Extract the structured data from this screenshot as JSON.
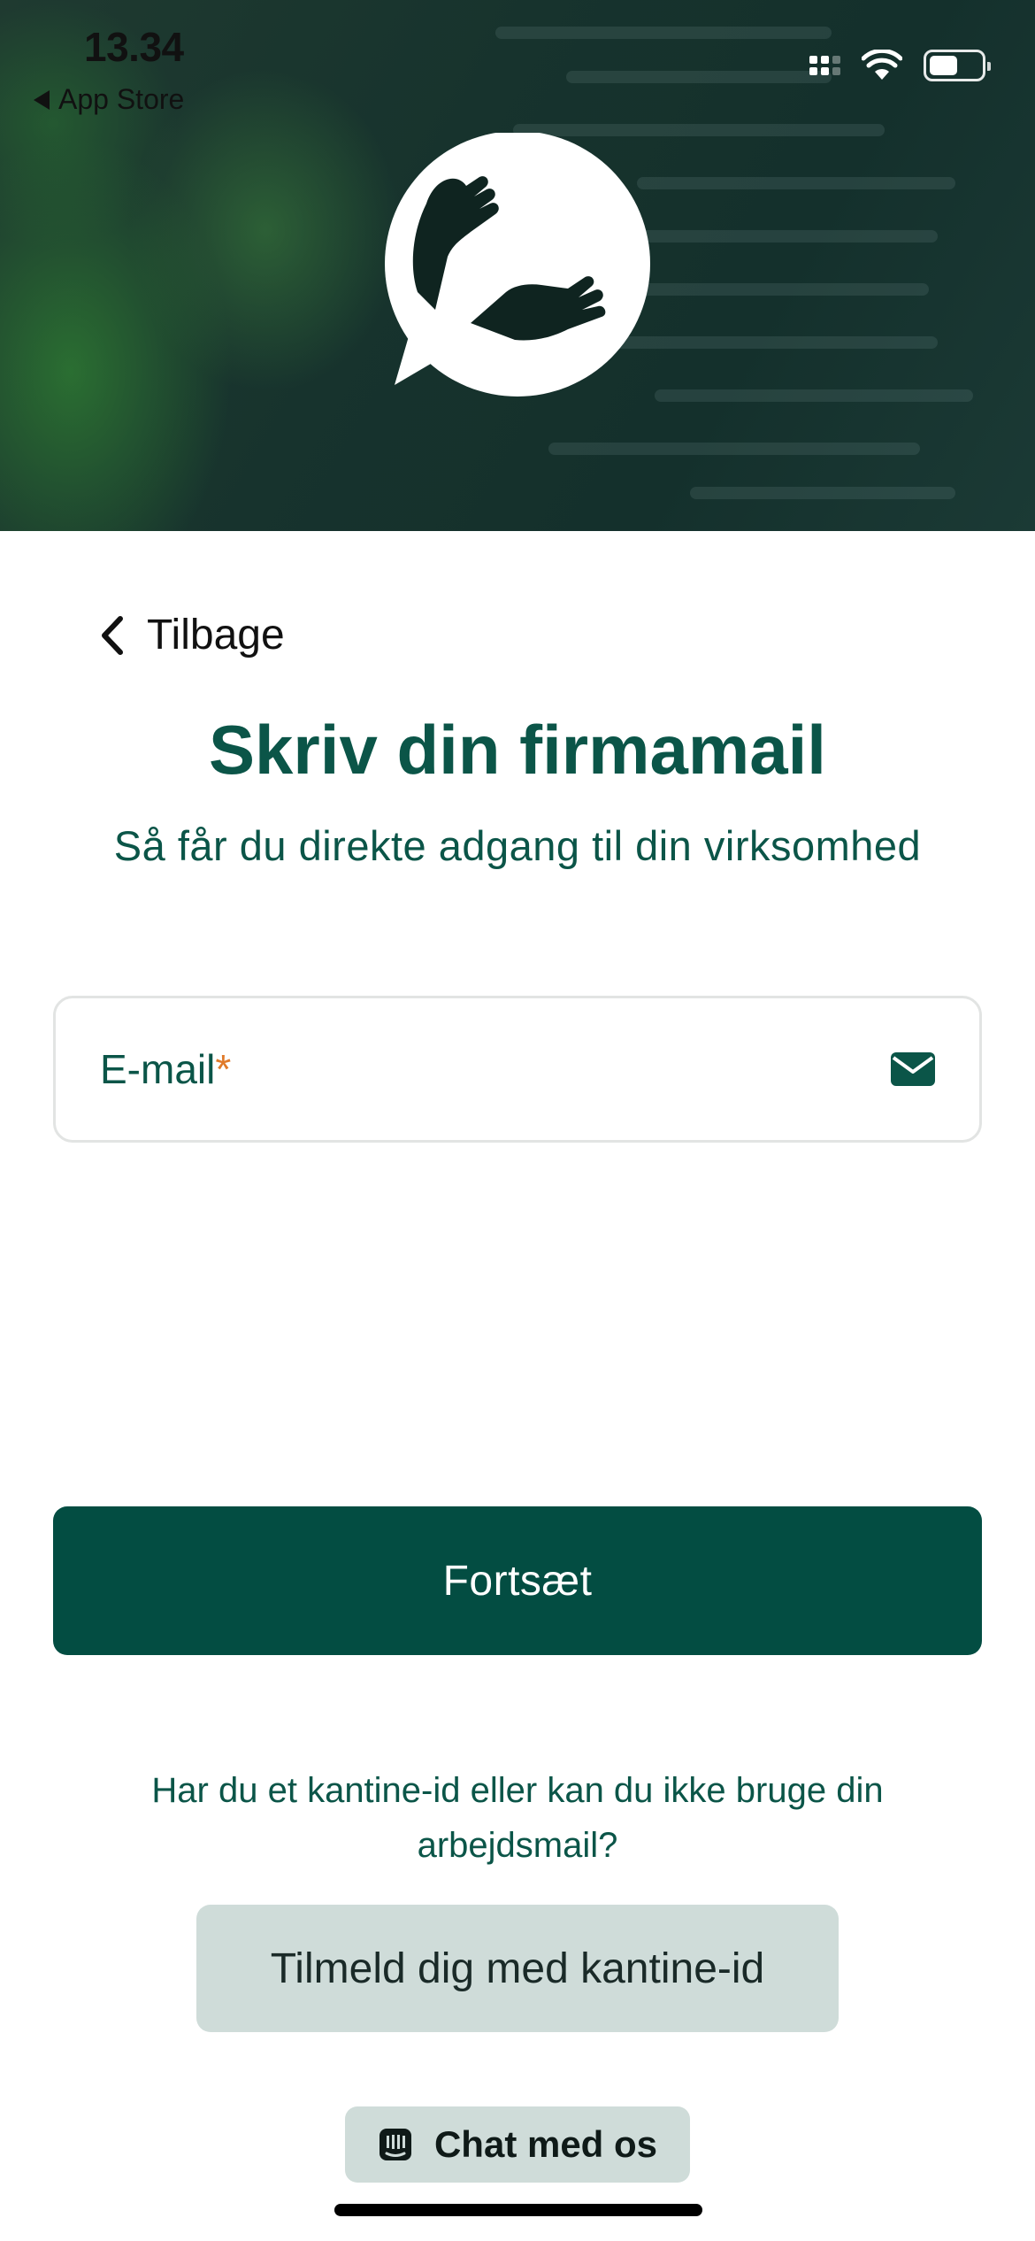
{
  "status_bar": {
    "time": "13.34",
    "back_app": "App Store"
  },
  "nav": {
    "back_label": "Tilbage"
  },
  "heading": {
    "title": "Skriv din firmamail",
    "subtitle": "Så får du direkte adgang til din virksomhed"
  },
  "email_field": {
    "placeholder": "E-mail",
    "required_marker": "*",
    "icon": "envelope-icon"
  },
  "primary_button": {
    "label": "Fortsæt"
  },
  "help": {
    "text": "Har du et kantine-id eller kan du ikke bruge din arbejdsmail?"
  },
  "secondary_button": {
    "label": "Tilmeld dig med kantine-id"
  },
  "chat_button": {
    "label": "Chat med os",
    "icon": "chat-icon"
  },
  "colors": {
    "brand": "#034d42",
    "text_green": "#0b5548",
    "accent_required": "#e07a2a",
    "secondary_bg": "#cfdcd9"
  }
}
